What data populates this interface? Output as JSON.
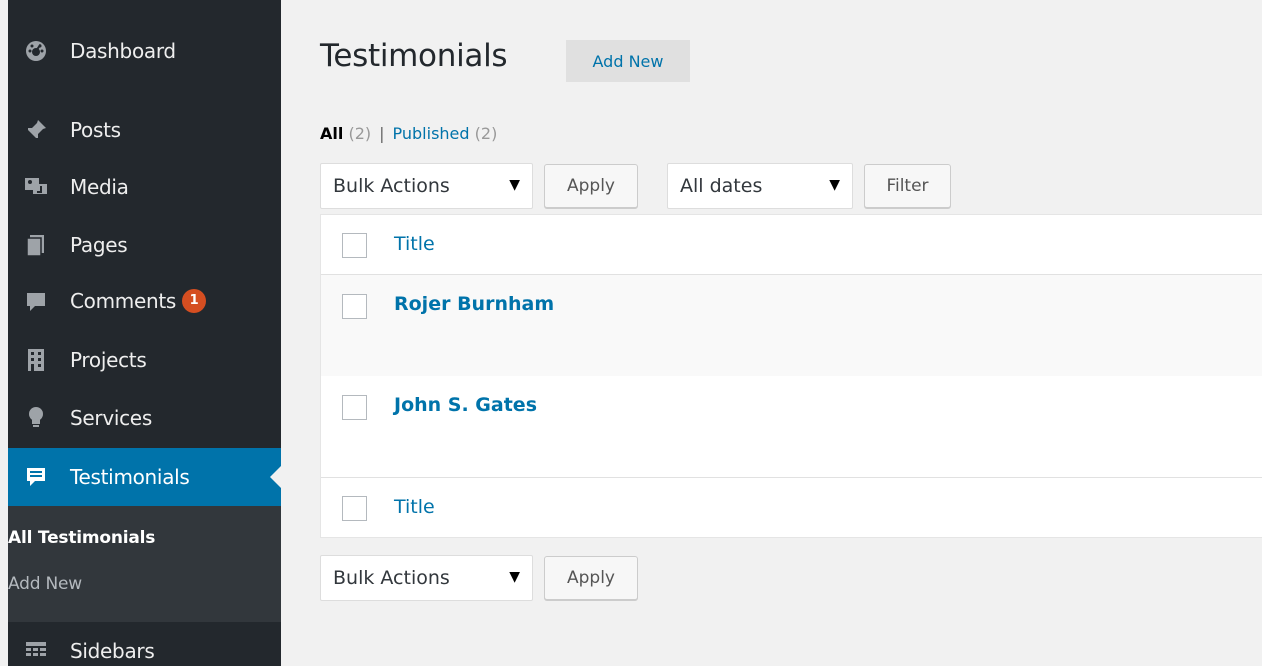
{
  "sidebar": {
    "items": [
      {
        "label": "Dashboard",
        "icon": "dashboard-icon"
      },
      {
        "label": "Posts",
        "icon": "pin-icon"
      },
      {
        "label": "Media",
        "icon": "media-icon"
      },
      {
        "label": "Pages",
        "icon": "pages-icon"
      },
      {
        "label": "Comments",
        "icon": "comment-icon",
        "badge": "1"
      },
      {
        "label": "Projects",
        "icon": "building-icon"
      },
      {
        "label": "Services",
        "icon": "lightbulb-icon"
      },
      {
        "label": "Testimonials",
        "icon": "testimonial-icon",
        "current": true
      },
      {
        "label": "Sidebars",
        "icon": "sidebars-icon"
      }
    ],
    "submenu": [
      {
        "label": "All Testimonials",
        "current": true
      },
      {
        "label": "Add New"
      }
    ],
    "accent_color": "#0073aa",
    "badge_color": "#d54e21"
  },
  "header": {
    "title": "Testimonials",
    "add_new_label": "Add New"
  },
  "views": {
    "all_label": "All",
    "all_count": "(2)",
    "separator": "|",
    "published_label": "Published",
    "published_count": "(2)"
  },
  "toolbar_top": {
    "bulk_actions": "Bulk Actions",
    "apply_label": "Apply",
    "dates": "All dates",
    "filter_label": "Filter"
  },
  "table": {
    "column_title": "Title",
    "rows": [
      {
        "title": "Rojer Burnham"
      },
      {
        "title": "John S. Gates"
      }
    ],
    "footer_title": "Title"
  },
  "toolbar_bottom": {
    "bulk_actions": "Bulk Actions",
    "apply_label": "Apply"
  }
}
